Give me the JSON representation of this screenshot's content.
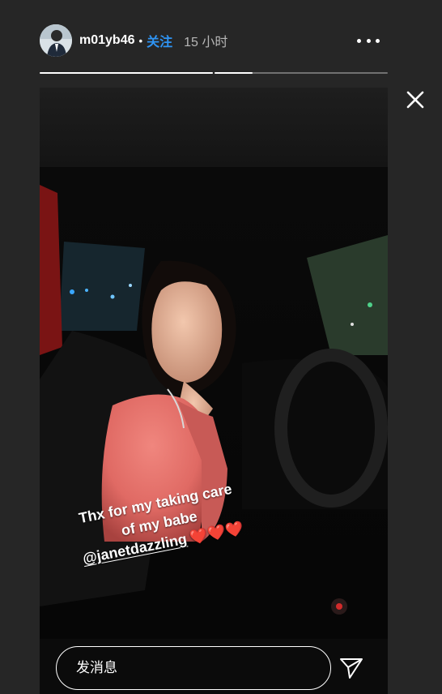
{
  "story": {
    "username": "m01yb46",
    "separator": "•",
    "follow_label": "关注",
    "timestamp": "15 小时",
    "progress": [
      1.0,
      0.22
    ],
    "caption": {
      "line1": "Thx for my taking care",
      "line2": "of my babe",
      "mention": "@janetdazzling",
      "hearts": "❤️❤️❤️"
    }
  },
  "icons": {
    "more": "more-options-icon",
    "close": "close-icon",
    "send": "send-icon"
  },
  "reply": {
    "placeholder": "发消息"
  },
  "colors": {
    "background": "#262626",
    "follow": "#2f94f3"
  }
}
